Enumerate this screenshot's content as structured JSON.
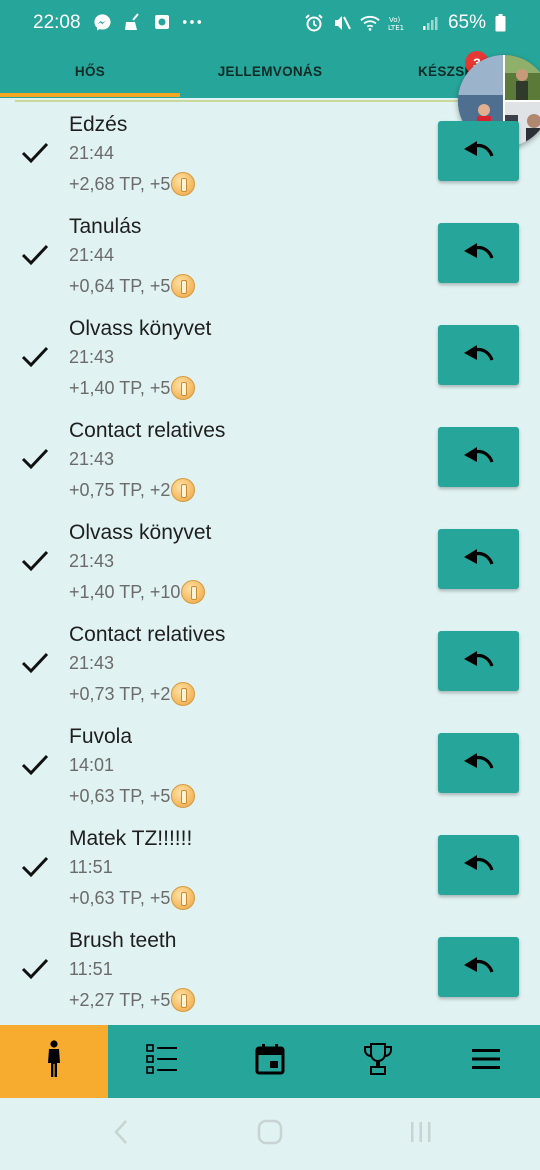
{
  "status_bar": {
    "time": "22:08",
    "battery": "65%",
    "left_icons": [
      "messenger-icon",
      "broom-icon",
      "screen-record-icon",
      "more-dots-icon"
    ],
    "right_icons": [
      "alarm-icon",
      "mute-icon",
      "wifi-icon",
      "volte-icon",
      "signal-icon",
      "battery-icon"
    ]
  },
  "tabs": [
    {
      "label": "HŐS",
      "active": true
    },
    {
      "label": "JELLEMVONÁS",
      "active": false
    },
    {
      "label": "KÉSZSÉ",
      "active": false
    }
  ],
  "tab_badge": "3",
  "history": [
    {
      "title": "Edzés",
      "time": "21:44",
      "reward": "+2,68 TP, +5"
    },
    {
      "title": "Tanulás",
      "time": "21:44",
      "reward": "+0,64 TP, +5"
    },
    {
      "title": "Olvass könyvet",
      "time": "21:43",
      "reward": "+1,40 TP, +5"
    },
    {
      "title": "Contact relatives",
      "time": "21:43",
      "reward": "+0,75 TP, +2"
    },
    {
      "title": "Olvass könyvet",
      "time": "21:43",
      "reward": "+1,40 TP, +10"
    },
    {
      "title": "Contact relatives",
      "time": "21:43",
      "reward": "+0,73 TP, +2"
    },
    {
      "title": "Fuvola",
      "time": "14:01",
      "reward": "+0,63 TP, +5"
    },
    {
      "title": "Matek TZ!!!!!!",
      "time": "11:51",
      "reward": "+0,63 TP, +5"
    },
    {
      "title": "Brush teeth",
      "time": "11:51",
      "reward": "+2,27 TP, +5"
    }
  ],
  "bottom_nav": [
    {
      "name": "hero-icon",
      "active": true
    },
    {
      "name": "checklist-icon",
      "active": false
    },
    {
      "name": "calendar-icon",
      "active": false
    },
    {
      "name": "trophy-icon",
      "active": false
    },
    {
      "name": "menu-icon",
      "active": false
    }
  ],
  "colors": {
    "primary": "#26a69a",
    "accent": "#f7ac2f",
    "background": "#e0f2f1",
    "badge": "#e53935"
  }
}
